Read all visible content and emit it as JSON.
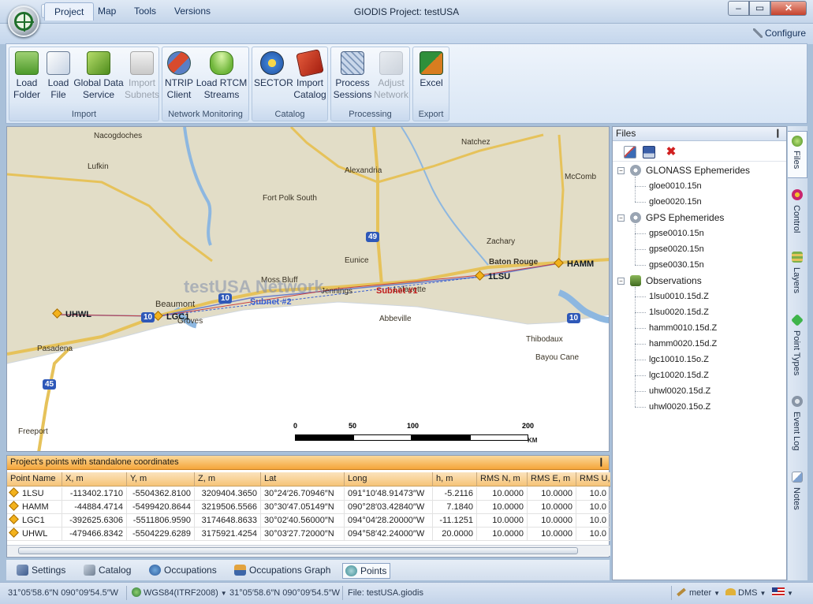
{
  "window": {
    "title": "GIODIS   Project: testUSA"
  },
  "ribbon": {
    "tabs": [
      "Project",
      "Map",
      "Tools",
      "Versions"
    ],
    "configure": "Configure",
    "groups": [
      {
        "title": "Import",
        "buttons": [
          {
            "label": "Load\nFolder"
          },
          {
            "label": "Load\nFile"
          },
          {
            "label": "Global Data\nService"
          },
          {
            "label": "Import\nSubnets"
          }
        ]
      },
      {
        "title": "Network Monitoring",
        "buttons": [
          {
            "label": "NTRIP\nClient"
          },
          {
            "label": "Load RTCM\nStreams"
          }
        ]
      },
      {
        "title": "Catalog",
        "buttons": [
          {
            "label": "SECTOR"
          },
          {
            "label": "Import\nCatalog"
          }
        ]
      },
      {
        "title": "Processing",
        "buttons": [
          {
            "label": "Process\nSessions"
          },
          {
            "label": "Adjust\nNetwork"
          }
        ]
      },
      {
        "title": "Export",
        "buttons": [
          {
            "label": "Excel"
          }
        ]
      }
    ]
  },
  "map": {
    "network_label": "testUSA Network",
    "subnet2": "Subnet #2",
    "subnet1": "Subnet #1",
    "cities": [
      "Nacogdoches",
      "Lufkin",
      "Natchez",
      "Alexandria",
      "McComb",
      "Fort Polk South",
      "Zachary",
      "Eunice",
      "Baton Rouge",
      "Moss Bluff",
      "Jennings",
      "Lafayette",
      "Beaumont",
      "Groves",
      "Abbeville",
      "Thibodaux",
      "Pasadena",
      "Bayou Cane",
      "Freeport"
    ],
    "points": [
      "UHWL",
      "LGC1",
      "1LSU",
      "HAMM"
    ],
    "highways": [
      "49",
      "10",
      "10",
      "10",
      "45"
    ],
    "scale": {
      "ticks": [
        "0",
        "50",
        "100",
        "200"
      ],
      "unit": "KM"
    }
  },
  "grid": {
    "title": "Project's points with standalone coordinates",
    "pin": "❙",
    "columns": [
      "Point Name",
      "X, m",
      "Y, m",
      "Z, m",
      "Lat",
      "Long",
      "h, m",
      "RMS N, m",
      "RMS E, m",
      "RMS U,"
    ],
    "rows": [
      [
        "1LSU",
        "-113402.1710",
        "-5504362.8100",
        "3209404.3650",
        "30°24′26.70946″N",
        "091°10′48.91473″W",
        "-5.2116",
        "10.0000",
        "10.0000",
        "10.0"
      ],
      [
        "HAMM",
        "-44884.4714",
        "-5499420.8644",
        "3219506.5566",
        "30°30′47.05149″N",
        "090°28′03.42840″W",
        "7.1840",
        "10.0000",
        "10.0000",
        "10.0"
      ],
      [
        "LGC1",
        "-392625.6306",
        "-5511806.9590",
        "3174648.8633",
        "30°02′40.56000″N",
        "094°04′28.20000″W",
        "-11.1251",
        "10.0000",
        "10.0000",
        "10.0"
      ],
      [
        "UHWL",
        "-479466.8342",
        "-5504229.6289",
        "3175921.4254",
        "30°03′27.72000″N",
        "094°58′42.24000″W",
        "20.0000",
        "10.0000",
        "10.0000",
        "10.0"
      ]
    ]
  },
  "bottom_tabs": [
    "Settings",
    "Catalog",
    "Occupations",
    "Occupations Graph",
    "Points"
  ],
  "files": {
    "title": "Files",
    "groups": [
      {
        "name": "GLONASS Ephemerides",
        "items": [
          "gloe0010.15n",
          "gloe0020.15n"
        ]
      },
      {
        "name": "GPS Ephemerides",
        "items": [
          "gpse0010.15n",
          "gpse0020.15n",
          "gpse0030.15n"
        ]
      },
      {
        "name": "Observations",
        "items": [
          "1lsu0010.15d.Z",
          "1lsu0020.15d.Z",
          "hamm0010.15d.Z",
          "hamm0020.15d.Z",
          "lgc10010.15o.Z",
          "lgc10020.15d.Z",
          "uhwl0020.15d.Z",
          "uhwl0020.15o.Z"
        ]
      }
    ]
  },
  "side_tabs": [
    "Files",
    "Control",
    "Layers",
    "Point Types",
    "Event Log",
    "Notes"
  ],
  "status": {
    "coord1": "31°05′58.6″N 090°09′54.5″W",
    "datum": "WGS84(ITRF2008)",
    "coord2": "31°05′58.6″N 090°09′54.5″W",
    "file": "File: testUSA.giodis",
    "unit": "meter",
    "format": "DMS"
  },
  "colors": {
    "accent": "#f5a53a",
    "ribbon": "#d9e6f5",
    "subnet1": "#c01a1a",
    "subnet2": "#3a5fd0",
    "water": "#a8c8e8",
    "land": "#e2ddc7",
    "road": "#e6c25a"
  }
}
